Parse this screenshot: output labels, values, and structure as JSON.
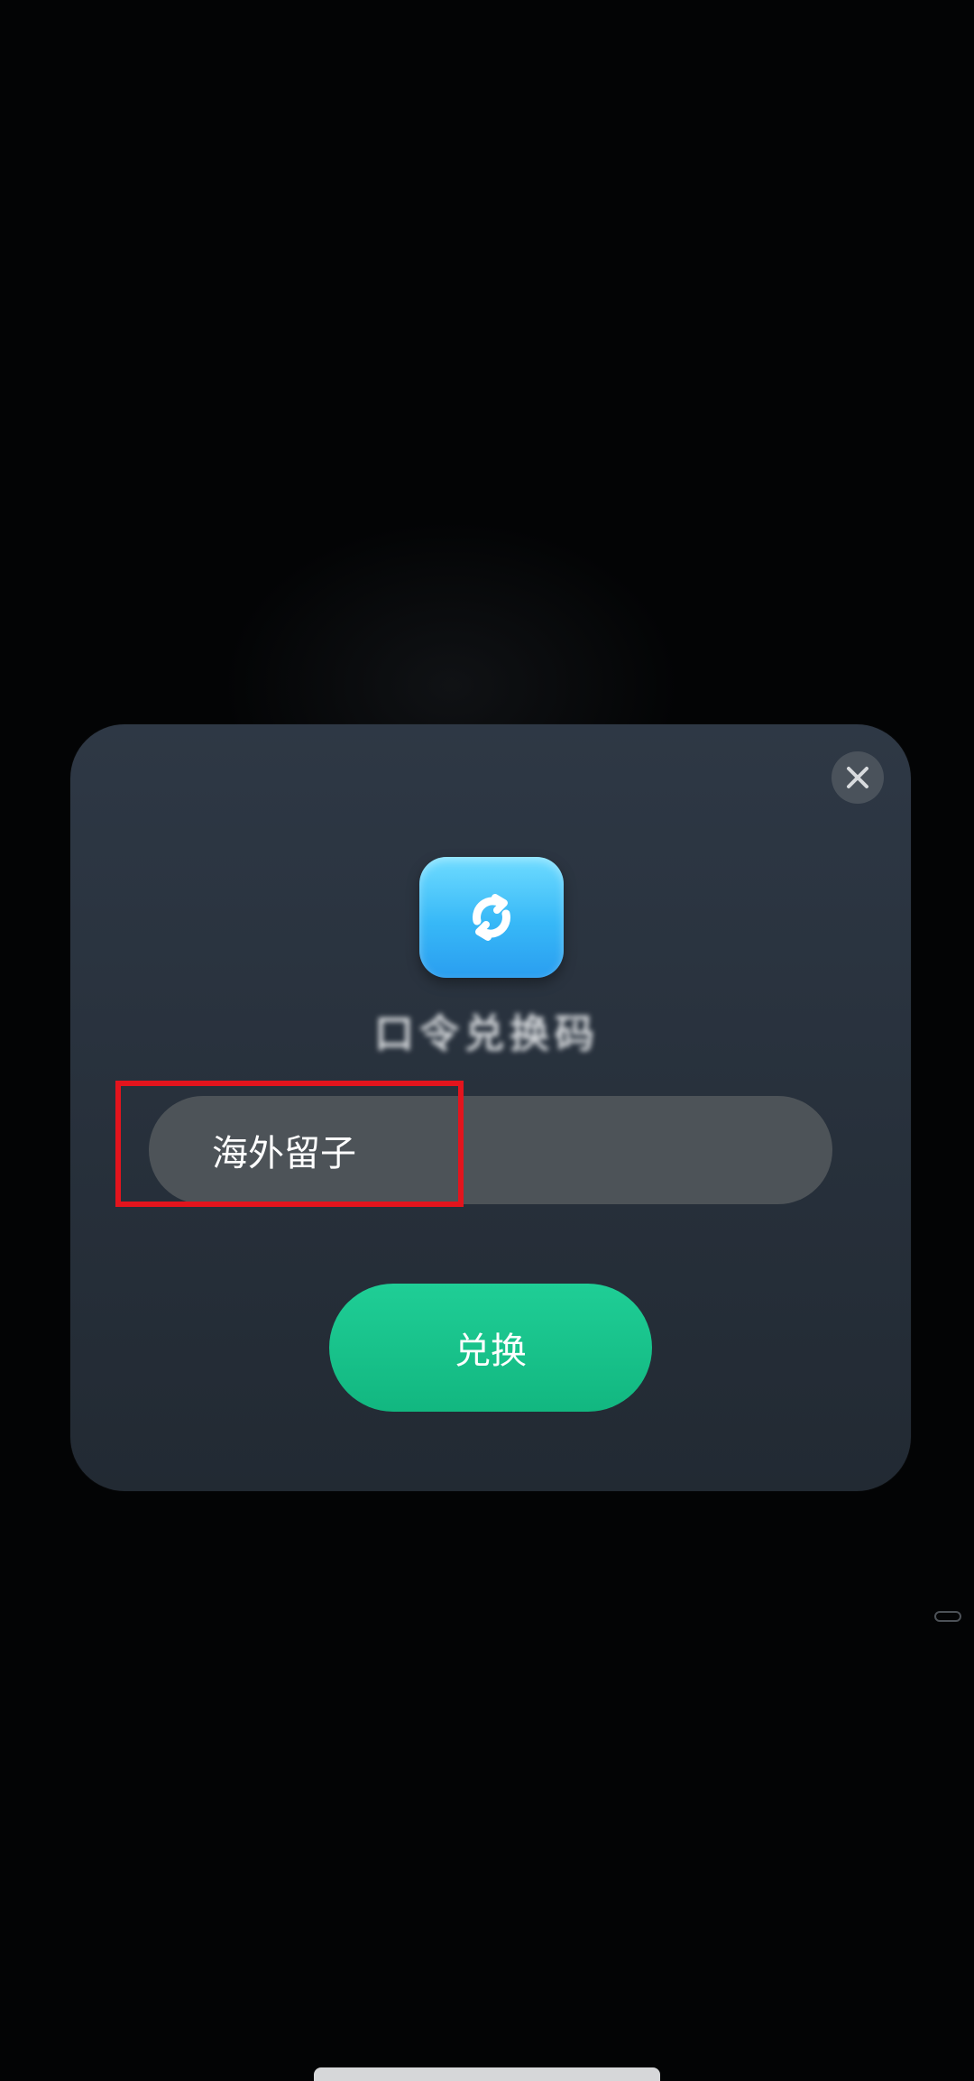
{
  "dialog": {
    "title": "口令兑换码",
    "input_value": "海外留子",
    "redeem_label": "兑换",
    "icons": {
      "close": "close-icon",
      "app": "refresh-cycle-icon"
    }
  },
  "colors": {
    "dialog_bg": "#2b3440",
    "input_bg": "#4d5358",
    "button_green": "#1bc58f",
    "highlight_red": "#e3141d",
    "app_icon_blue": "#4cc6fb"
  }
}
